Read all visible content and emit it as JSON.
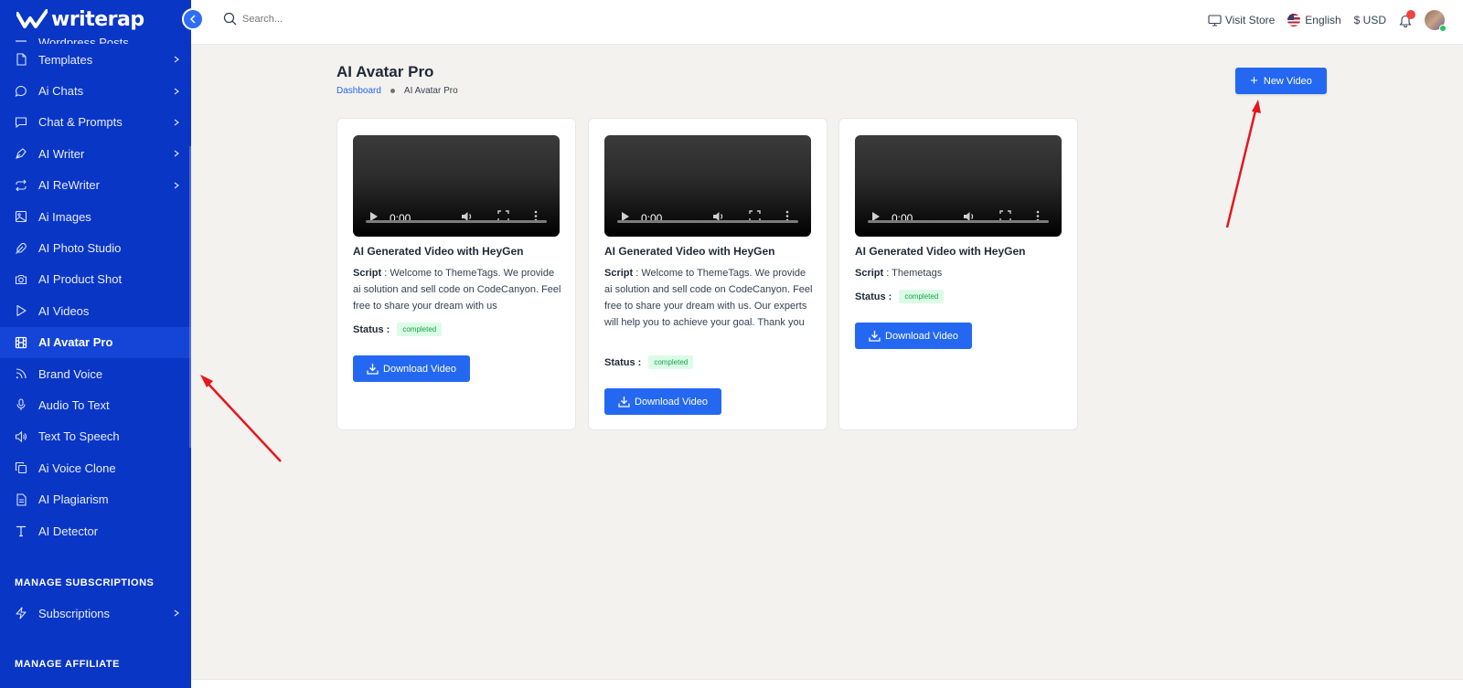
{
  "app": {
    "logo_text": "writerap"
  },
  "search": {
    "placeholder": "Search..."
  },
  "header": {
    "visit_store": "Visit Store",
    "language": "English",
    "currency": "$ USD"
  },
  "sidebar": {
    "clipped_item": "Wordpress Posts",
    "items": [
      {
        "label": "Templates",
        "icon": "file-icon",
        "chevron": true
      },
      {
        "label": "Ai Chats",
        "icon": "chat-bubble-icon",
        "chevron": true
      },
      {
        "label": "Chat & Prompts",
        "icon": "message-square-icon",
        "chevron": true
      },
      {
        "label": "AI Writer",
        "icon": "pen-tool-icon",
        "chevron": true
      },
      {
        "label": "AI ReWriter",
        "icon": "repeat-icon",
        "chevron": true
      },
      {
        "label": "Ai Images",
        "icon": "image-icon",
        "chevron": false
      },
      {
        "label": "AI Photo Studio",
        "icon": "feather-icon",
        "chevron": false
      },
      {
        "label": "AI Product Shot",
        "icon": "camera-icon",
        "chevron": false
      },
      {
        "label": "AI Videos",
        "icon": "play-icon",
        "chevron": false
      },
      {
        "label": "AI Avatar Pro",
        "icon": "film-icon",
        "chevron": false,
        "active": true
      },
      {
        "label": "Brand Voice",
        "icon": "rss-icon",
        "chevron": false
      },
      {
        "label": "Audio To Text",
        "icon": "microphone-icon",
        "chevron": false
      },
      {
        "label": "Text To Speech",
        "icon": "speaker-icon",
        "chevron": false
      },
      {
        "label": "Ai Voice Clone",
        "icon": "copy-icon",
        "chevron": false
      },
      {
        "label": "AI Plagiarism",
        "icon": "document-icon",
        "chevron": false
      },
      {
        "label": "AI Detector",
        "icon": "type-icon",
        "chevron": false
      }
    ],
    "section_subscriptions": "MANAGE SUBSCRIPTIONS",
    "subscriptions_item": "Subscriptions",
    "section_affiliate": "MANAGE AFFILIATE"
  },
  "main": {
    "title": "AI Avatar Pro",
    "breadcrumb": {
      "home": "Dashboard",
      "current": "AI Avatar Pro"
    },
    "new_video_label": "New Video",
    "cards": [
      {
        "title": "AI Generated Video with HeyGen",
        "script_label": "Script",
        "script": "Welcome to ThemeTags. We provide ai solution and sell code on CodeCanyon. Feel free to share your dream with us",
        "status_label": "Status :",
        "status": "completed",
        "video_time": "0:00",
        "download_label": "Download Video"
      },
      {
        "title": "AI Generated Video with HeyGen",
        "script_label": "Script",
        "script": "Welcome to ThemeTags. We provide ai solution and sell code on CodeCanyon. Feel free to share your dream with us. Our experts will help you to achieve your goal. Thank you",
        "status_label": "Status :",
        "status": "completed",
        "video_time": "0:00",
        "download_label": "Download Video"
      },
      {
        "title": "AI Generated Video with HeyGen",
        "script_label": "Script",
        "script": "Themetags",
        "status_label": "Status :",
        "status": "completed",
        "video_time": "0:00",
        "download_label": "Download Video"
      }
    ]
  },
  "colors": {
    "sidebar_bg": "#0a36c6",
    "primary_button": "#2468f2",
    "status_badge_bg": "#dcfce7",
    "status_badge_text": "#16a34a",
    "annotation_arrow": "#e5161e"
  }
}
